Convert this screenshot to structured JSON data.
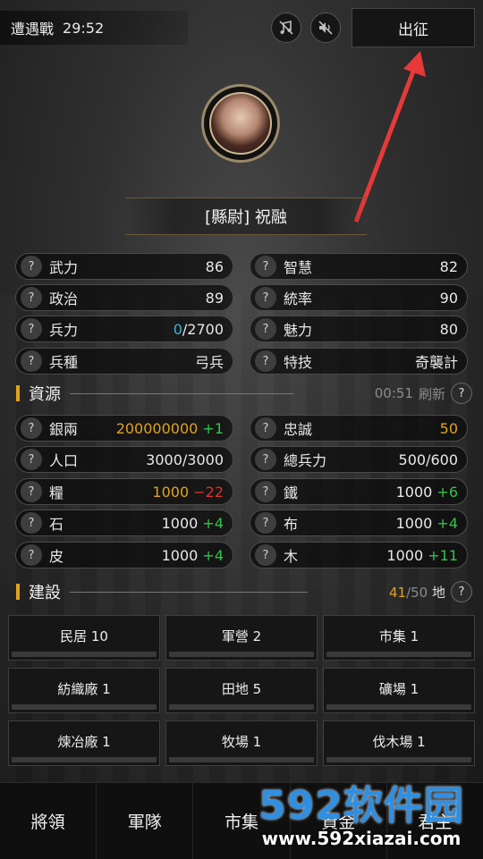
{
  "topbar": {
    "mode_label": "遭遇戰",
    "timer": "29:52",
    "music_icon": "music-off-icon",
    "sound_icon": "sound-off-icon",
    "deploy_button": "出征"
  },
  "hero": {
    "avatar_icon": "portrait",
    "name": "[縣尉] 祝融"
  },
  "stats": [
    {
      "label": "武力",
      "value": "86"
    },
    {
      "label": "智慧",
      "value": "82"
    },
    {
      "label": "政治",
      "value": "89"
    },
    {
      "label": "統率",
      "value": "90"
    },
    {
      "label": "兵力",
      "value_a": "0",
      "value_b": "/2700"
    },
    {
      "label": "魅力",
      "value": "80"
    },
    {
      "label": "兵種",
      "value": "弓兵"
    },
    {
      "label": "特技",
      "value": "奇襲計"
    }
  ],
  "resources_section": {
    "title": "資源",
    "refresh_time": "00:51",
    "refresh_label": "刷新"
  },
  "resources": [
    {
      "label": "銀兩",
      "value": "200000000",
      "delta": "+1"
    },
    {
      "label": "忠誠",
      "value": "50"
    },
    {
      "label": "人口",
      "value": "3000/3000"
    },
    {
      "label": "總兵力",
      "value": "500/600"
    },
    {
      "label": "糧",
      "value": "1000",
      "delta": "−22"
    },
    {
      "label": "鐵",
      "value": "1000",
      "delta": "+6"
    },
    {
      "label": "石",
      "value": "1000",
      "delta": "+4"
    },
    {
      "label": "布",
      "value": "1000",
      "delta": "+4"
    },
    {
      "label": "皮",
      "value": "1000",
      "delta": "+4"
    },
    {
      "label": "木",
      "value": "1000",
      "delta": "+11"
    }
  ],
  "build_section": {
    "title": "建設",
    "used": "41",
    "total": "/50",
    "unit": "地"
  },
  "buildings": [
    {
      "label": "民居  10"
    },
    {
      "label": "軍營  2"
    },
    {
      "label": "市集  1"
    },
    {
      "label": "紡織廠  1"
    },
    {
      "label": "田地  5"
    },
    {
      "label": "礦場  1"
    },
    {
      "label": "煉冶廠  1"
    },
    {
      "label": "牧場  1"
    },
    {
      "label": "伐木場  1"
    }
  ],
  "nav": [
    {
      "label": "將領"
    },
    {
      "label": "軍隊"
    },
    {
      "label": "市集"
    },
    {
      "label": "資金"
    },
    {
      "label": "君主"
    }
  ],
  "watermark": {
    "logo": "592软件园",
    "url": "www.592xiazai.com"
  },
  "colors": {
    "accent": "#e0a21f",
    "positive": "#37c24a",
    "negative": "#e0302c",
    "troops": "#3fb3d6",
    "arrow": "#e63a3a"
  }
}
